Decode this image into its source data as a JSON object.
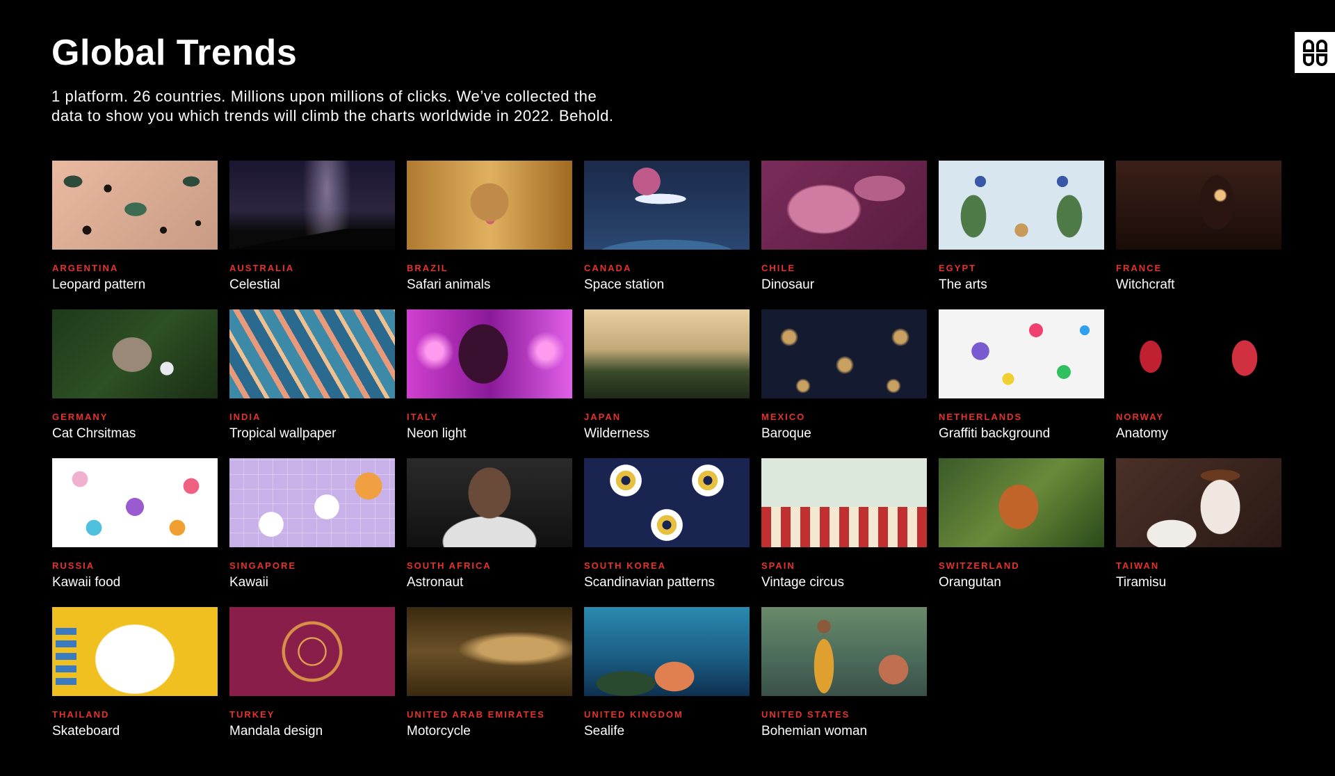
{
  "header": {
    "title": "Global Trends",
    "subtitle_line1": "1 platform. 26 countries. Millions upon millions of clicks. We’ve collected the",
    "subtitle_line2": "data to show you which trends will climb the charts worldwide in 2022. Behold."
  },
  "colors": {
    "background": "#000000",
    "accent": "#e5322d",
    "text": "#ffffff"
  },
  "trends": [
    {
      "country": "ARGENTINA",
      "trend": "Leopard pattern"
    },
    {
      "country": "AUSTRALIA",
      "trend": "Celestial"
    },
    {
      "country": "BRAZIL",
      "trend": "Safari animals"
    },
    {
      "country": "CANADA",
      "trend": "Space station"
    },
    {
      "country": "CHILE",
      "trend": "Dinosaur"
    },
    {
      "country": "EGYPT",
      "trend": "The arts"
    },
    {
      "country": "FRANCE",
      "trend": "Witchcraft"
    },
    {
      "country": "GERMANY",
      "trend": "Cat Chrsitmas"
    },
    {
      "country": "INDIA",
      "trend": "Tropical wallpaper"
    },
    {
      "country": "ITALY",
      "trend": "Neon light"
    },
    {
      "country": "JAPAN",
      "trend": "Wilderness"
    },
    {
      "country": "MEXICO",
      "trend": "Baroque"
    },
    {
      "country": "NETHERLANDS",
      "trend": "Graffiti background"
    },
    {
      "country": "NORWAY",
      "trend": "Anatomy"
    },
    {
      "country": "RUSSIA",
      "trend": "Kawaii food"
    },
    {
      "country": "SINGAPORE",
      "trend": "Kawaii"
    },
    {
      "country": "SOUTH AFRICA",
      "trend": "Astronaut"
    },
    {
      "country": "SOUTH KOREA",
      "trend": "Scandinavian patterns"
    },
    {
      "country": "SPAIN",
      "trend": "Vintage circus"
    },
    {
      "country": "SWITZERLAND",
      "trend": "Orangutan"
    },
    {
      "country": "TAIWAN",
      "trend": "Tiramisu"
    },
    {
      "country": "THAILAND",
      "trend": "Skateboard"
    },
    {
      "country": "TURKEY",
      "trend": "Mandala design"
    },
    {
      "country": "UNITED ARAB EMIRATES",
      "trend": "Motorcycle"
    },
    {
      "country": "UNITED KINGDOM",
      "trend": "Sealife"
    },
    {
      "country": "UNITED STATES",
      "trend": "Bohemian woman"
    }
  ]
}
